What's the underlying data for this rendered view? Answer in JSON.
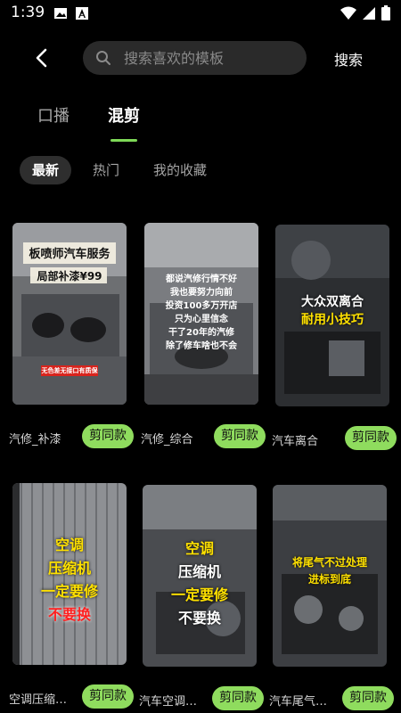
{
  "status_bar": {
    "time": "1:39"
  },
  "header": {
    "search_placeholder": "搜索喜欢的模板",
    "search_button": "搜索"
  },
  "main_tabs": [
    {
      "label": "口播",
      "active": false
    },
    {
      "label": "混剪",
      "active": true
    }
  ],
  "sub_tabs": [
    {
      "label": "最新",
      "active": true
    },
    {
      "label": "热门",
      "active": false
    },
    {
      "label": "我的收藏",
      "active": false
    }
  ],
  "cards": [
    {
      "title": "汽修_补漆",
      "button": "剪同款",
      "overlay_lines": [
        "板喷师汽车服务",
        "局部补漆¥99"
      ],
      "overlay_small": "无色差无接口有质保"
    },
    {
      "title": "汽修_综合",
      "button": "剪同款",
      "overlay_lines": [
        "都说汽修行情不好",
        "我也要努力向前",
        "投资100多万开店",
        "只为心里信念",
        "干了20年的汽修",
        "除了修车啥也不会"
      ]
    },
    {
      "title": "汽车离合",
      "button": "剪同款",
      "overlay_lines": [
        "大众双离合",
        "耐用小技巧"
      ]
    },
    {
      "title": "空调压缩…",
      "button": "剪同款",
      "overlay_lines": [
        "空调",
        "压缩机",
        "一定要修",
        "不要换"
      ]
    },
    {
      "title": "汽车空调…",
      "button": "剪同款",
      "overlay_lines": [
        "空调",
        "压缩机",
        "一定要修",
        "不要换"
      ]
    },
    {
      "title": "汽车尾气…",
      "button": "剪同款",
      "overlay_lines": [
        "将尾气不过处理",
        "进标到底"
      ]
    }
  ],
  "colors": {
    "accent_green": "#8fdc5e",
    "tab_underline": "#7ed957",
    "search_bg": "#2a2a2a",
    "background": "#000000"
  }
}
